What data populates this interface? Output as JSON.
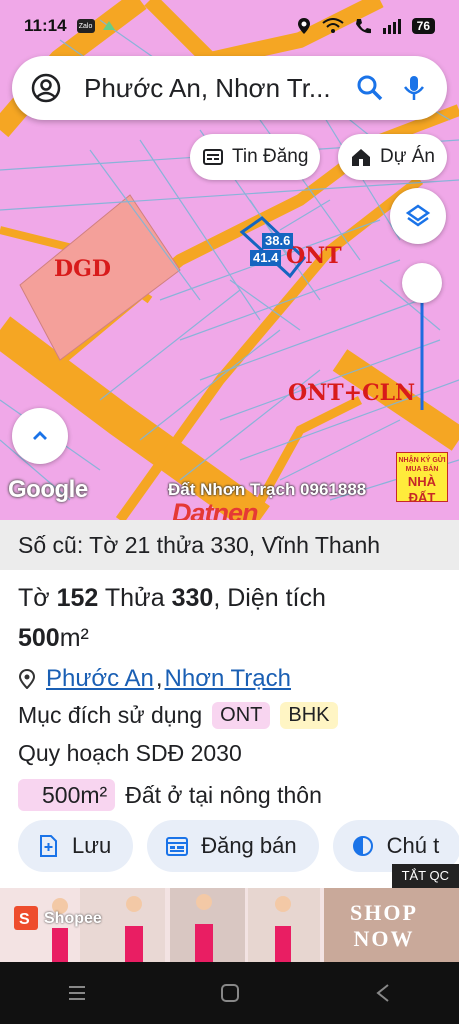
{
  "status_bar": {
    "time": "11:14",
    "notif_app": "Zalo",
    "battery": "76"
  },
  "search": {
    "query": "Phước An, Nhơn Tr..."
  },
  "chips": {
    "tin_dang": "Tin Đăng",
    "du_an": "Dự Án"
  },
  "map": {
    "labels": {
      "dgd": "DGD",
      "ont": "ONT",
      "ont_cln": "ONT+CLN"
    },
    "dimensions": [
      "38.6",
      "41.4"
    ],
    "google_logo": "Google",
    "watermark": "Đất Nhơn Trạch 0961888",
    "datnen": "Datnen",
    "badge": {
      "line1": "NHẬN KÝ GỬI",
      "line2": "MUA BÁN",
      "line3": "NHÀ ĐẤT"
    }
  },
  "sheet": {
    "old_number": "Số cũ: Tờ 21 thửa 330, Vĩnh Thanh",
    "to_label": "Tờ",
    "to_value": "152",
    "thua_label": "Thửa",
    "thua_value": "330",
    "dien_tich_label": ", Diện tích",
    "area_value": "500",
    "area_unit": "m²",
    "location_ward": "Phước An",
    "location_district": "Nhơn Trạch",
    "purpose_label": "Mục đích sử dụng",
    "purpose_tags": [
      "ONT",
      "BHK"
    ],
    "planning_label": "Quy hoạch SDĐ 2030",
    "plan_area": "500m²",
    "plan_desc": "Đất ở tại nông thôn",
    "actions": {
      "save": "Lưu",
      "post": "Đăng bán",
      "note": "Chú t"
    }
  },
  "ad": {
    "close_label": "TẮT QC",
    "brand": "Shopee",
    "cta_line1": "SHOP",
    "cta_line2": "NOW"
  },
  "colors": {
    "map_bg": "#f0a8e8",
    "road": "#f5a623",
    "accent": "#1565c0",
    "label_red": "#d81b1b"
  }
}
